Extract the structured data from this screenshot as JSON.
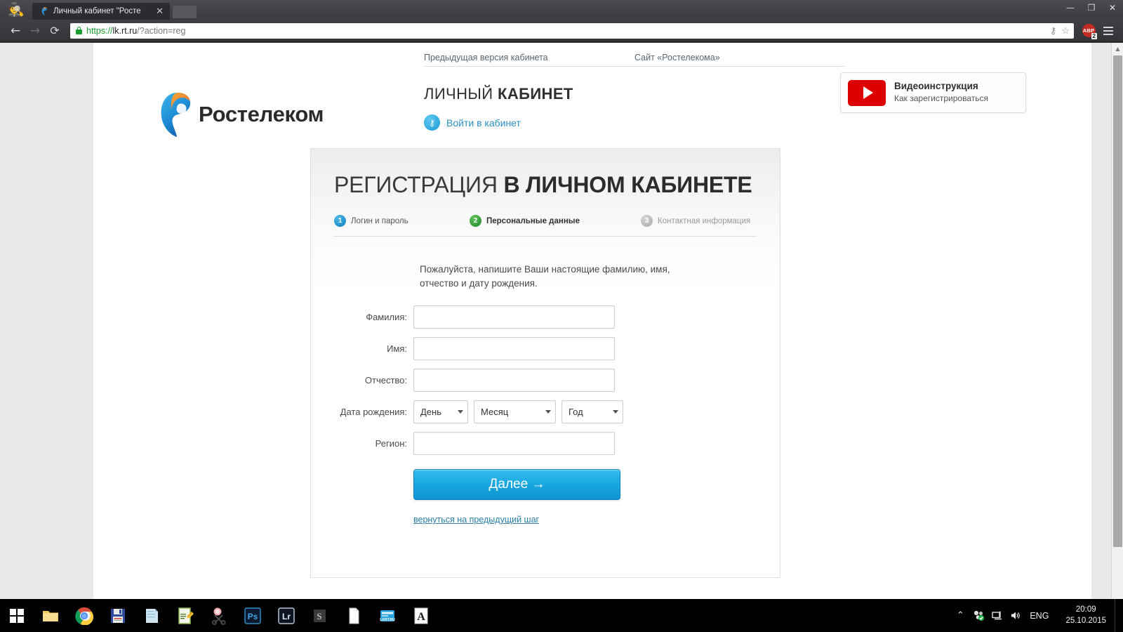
{
  "browser": {
    "tab": {
      "title": "Личный кабинет \"Росте",
      "close_label": "✕",
      "favicon": "rostelecom-favicon"
    },
    "window_controls": {
      "minimize": "—",
      "maximize": "❐",
      "close": "✕"
    },
    "nav": {
      "back": "←",
      "forward": "→",
      "reload": "⟳"
    },
    "url": {
      "scheme": "https://",
      "host": "lk.rt.ru",
      "rest": "/?action=reg",
      "full": "https://lk.rt.ru/?action=reg"
    },
    "omnibox_icons": {
      "key": "⚷",
      "bookmark": "☆"
    },
    "extensions": {
      "abp_label": "ABP",
      "abp_badge": "2"
    },
    "menu_label": "menu"
  },
  "site": {
    "topnav": [
      {
        "label": "Предыдущая версия кабинета"
      },
      {
        "label": "Сайт «Ростелекома»"
      }
    ],
    "brand": {
      "word": "Ростелеком"
    },
    "cabinet": {
      "title_light": "ЛИЧНЫЙ ",
      "title_bold": "КАБИНЕТ",
      "login_link": "Войти в кабинет"
    },
    "video": {
      "title": "Видеоинструкция",
      "subtitle": "Как зарегистрироваться"
    }
  },
  "registration": {
    "heading_light": "РЕГИСТРАЦИЯ ",
    "heading_bold": "В ЛИЧНОМ КАБИНЕТЕ",
    "steps": [
      {
        "num": "1",
        "label": "Логин и пароль",
        "color": "#1a8bc8",
        "state": "done"
      },
      {
        "num": "2",
        "label": "Персональные данные",
        "color": "#3f9c3a",
        "state": "current"
      },
      {
        "num": "3",
        "label": "Контактная информация",
        "color": "#b5b5b5",
        "state": "upcoming"
      }
    ],
    "intro": "Пожалуйста, напишите Ваши настоящие фамилию, имя, отчество и дату рождения.",
    "fields": [
      {
        "label": "Фамилия:",
        "value": "",
        "placeholder": ""
      },
      {
        "label": "Имя:",
        "value": "",
        "placeholder": ""
      },
      {
        "label": "Отчество:",
        "value": "",
        "placeholder": ""
      }
    ],
    "dob": {
      "label": "Дата рождения:",
      "day": "День",
      "month": "Месяц",
      "year": "Год"
    },
    "region": {
      "label": "Регион:",
      "value": "",
      "placeholder": ""
    },
    "submit": {
      "label": "Далее  →",
      "color": "#19a7e0"
    },
    "back_link": "вернуться на предыдущий шаг"
  },
  "taskbar": {
    "start": "start-button",
    "items": [
      {
        "name": "file-explorer"
      },
      {
        "name": "google-chrome"
      },
      {
        "name": "save-floppy-app"
      },
      {
        "name": "notepad-app"
      },
      {
        "name": "text-editor-app"
      },
      {
        "name": "snipping-tool"
      },
      {
        "name": "photoshop",
        "label": "Ps"
      },
      {
        "name": "lightroom",
        "label": "Lr"
      },
      {
        "name": "script-app"
      },
      {
        "name": "document-app"
      },
      {
        "name": "rt-ru-app",
        "label": "LKRT.RU"
      },
      {
        "name": "font-app",
        "label": "A"
      }
    ],
    "tray": {
      "chevron": "⌃",
      "network_icon": "network-icon",
      "display_icon": "display-icon",
      "volume_icon": "🔊",
      "language": "ENG",
      "time": "20:09",
      "date": "25.10.2015"
    }
  }
}
